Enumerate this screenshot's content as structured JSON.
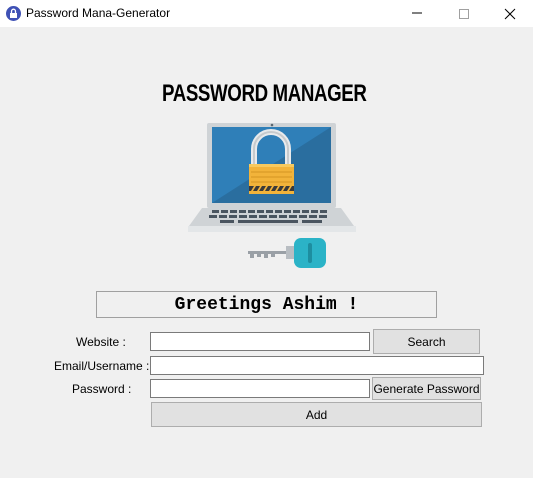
{
  "window": {
    "title": "Password Mana-Generator",
    "icon": "lock-shield-icon"
  },
  "titlebar_controls": {
    "minimize": "minimize-icon",
    "maximize": "maximize-icon",
    "close": "close-icon"
  },
  "header": {
    "title": "PASSWORD MANAGER",
    "logo": "laptop-padlock-key-logo"
  },
  "greeting": "Greetings Ashim !",
  "form": {
    "website_label": "Website :",
    "website_value": "",
    "email_label": "Email/Username :",
    "email_value": "",
    "password_label": "Password :",
    "password_value": ""
  },
  "buttons": {
    "search": "Search",
    "generate": "Generate Password",
    "add": "Add"
  },
  "colors": {
    "background": "#f0f0f0",
    "laptop_screen": "#2f7fb8",
    "padlock": "#f2b33a",
    "key": "#2bb3c7"
  }
}
